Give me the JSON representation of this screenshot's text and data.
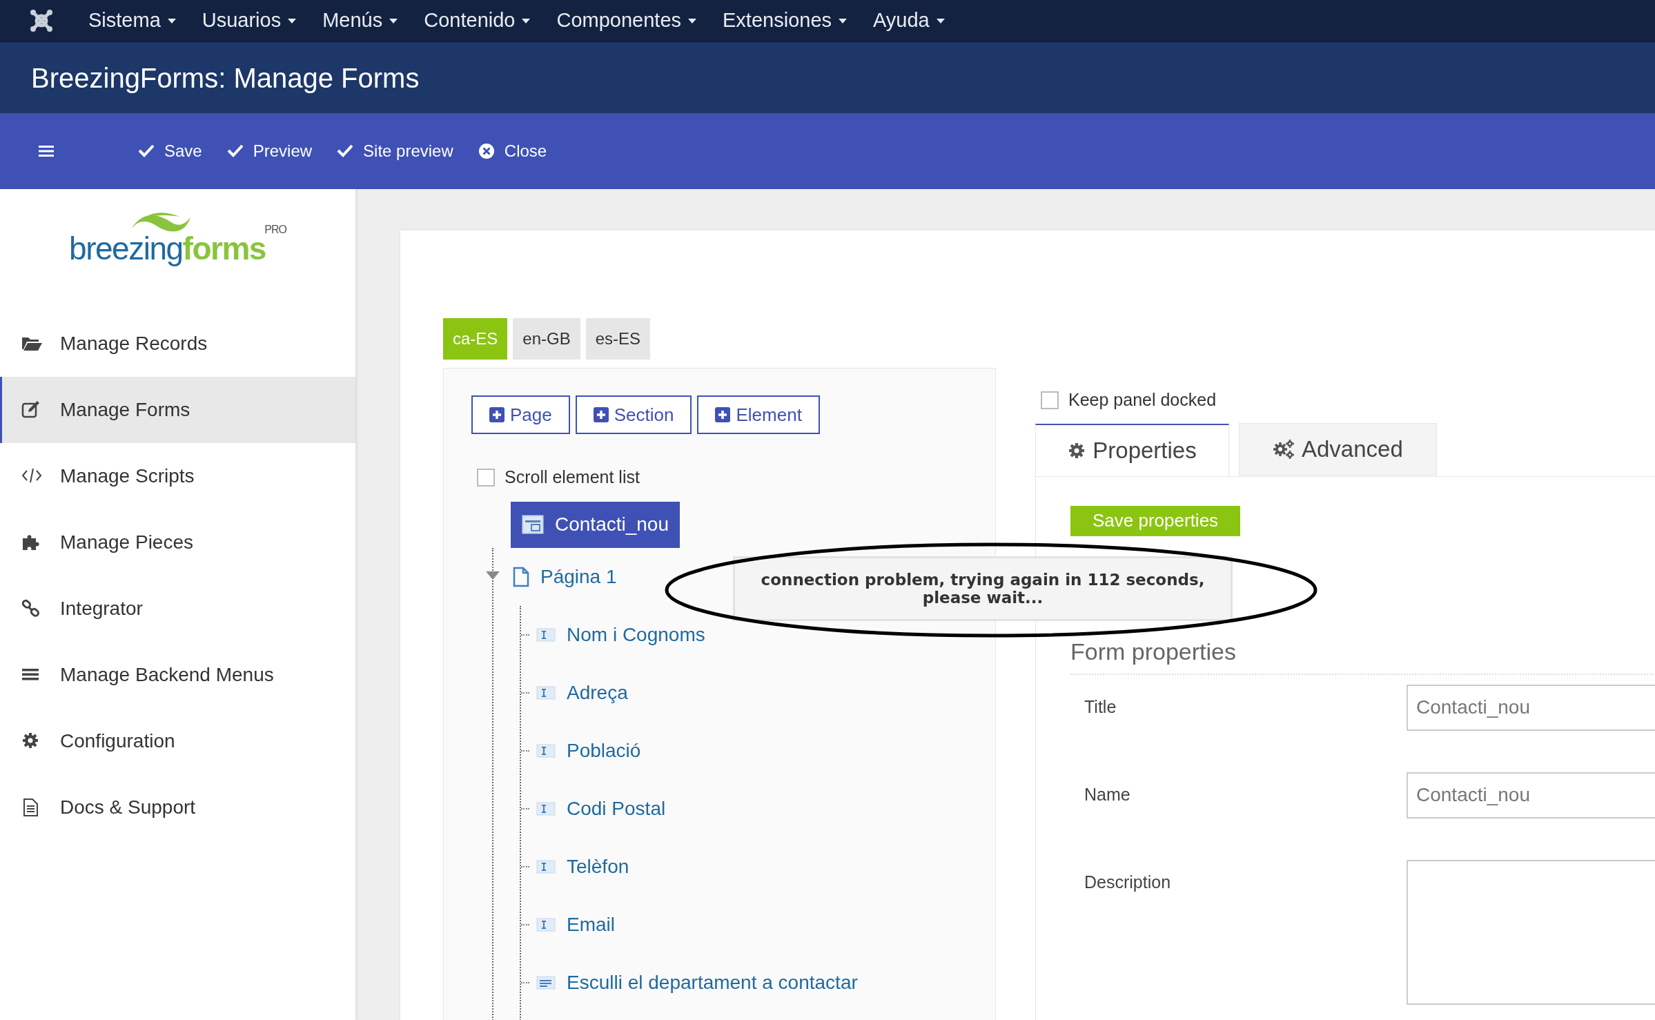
{
  "top_menu": {
    "items": [
      {
        "label": "Sistema"
      },
      {
        "label": "Usuarios"
      },
      {
        "label": "Menús"
      },
      {
        "label": "Contenido"
      },
      {
        "label": "Componentes"
      },
      {
        "label": "Extensiones"
      },
      {
        "label": "Ayuda"
      }
    ]
  },
  "header": {
    "title": "BreezingForms: Manage Forms"
  },
  "toolbar": {
    "buttons": [
      {
        "label": "Save",
        "kind": "check"
      },
      {
        "label": "Preview",
        "kind": "check"
      },
      {
        "label": "Site preview",
        "kind": "check"
      },
      {
        "label": "Close",
        "kind": "close"
      }
    ]
  },
  "sidebar": {
    "logo": {
      "word_1": "breezing",
      "word_2": "forms",
      "badge": "PRO"
    },
    "items": [
      {
        "label": "Manage Records",
        "kind": "folder",
        "selected": false
      },
      {
        "label": "Manage Forms",
        "kind": "edit",
        "selected": true
      },
      {
        "label": "Manage Scripts",
        "kind": "code",
        "selected": false
      },
      {
        "label": "Manage Pieces",
        "kind": "puzzle",
        "selected": false
      },
      {
        "label": "Integrator",
        "kind": "link",
        "selected": false
      },
      {
        "label": "Manage Backend Menus",
        "kind": "bars",
        "selected": false
      },
      {
        "label": "Configuration",
        "kind": "gear",
        "selected": false
      },
      {
        "label": "Docs & Support",
        "kind": "doc",
        "selected": false
      }
    ]
  },
  "language_tabs": [
    {
      "label": "ca-ES",
      "selected": true
    },
    {
      "label": "en-GB",
      "selected": false
    },
    {
      "label": "es-ES",
      "selected": false
    }
  ],
  "structure_panel": {
    "add_buttons": [
      {
        "label": "Page"
      },
      {
        "label": "Section"
      },
      {
        "label": "Element"
      }
    ],
    "scroll_element_list": {
      "label": "Scroll element list",
      "checked": false
    },
    "tree": {
      "label": "Contacti_nou",
      "selected": true,
      "children": [
        {
          "label": "Página 1",
          "kind": "page",
          "expanded": true,
          "children": [
            {
              "label": "Nom i Cognoms",
              "kind": "text"
            },
            {
              "label": "Adreça",
              "kind": "text"
            },
            {
              "label": "Població",
              "kind": "text"
            },
            {
              "label": "Codi Postal",
              "kind": "text"
            },
            {
              "label": "Telèfon",
              "kind": "text"
            },
            {
              "label": "Email",
              "kind": "text"
            },
            {
              "label": "Esculli el departament a contactar",
              "kind": "select"
            }
          ]
        }
      ]
    }
  },
  "properties_panel": {
    "keep_panel_docked": {
      "label": "Keep panel docked",
      "checked": false
    },
    "tabs": [
      {
        "label": "Properties",
        "kind": "gear",
        "selected": true
      },
      {
        "label": "Advanced",
        "kind": "gears",
        "selected": false
      }
    ],
    "save_button": "Save properties",
    "heading": "Form properties",
    "fields": [
      {
        "label": "Title",
        "value": "Contacti_nou",
        "kind": "input"
      },
      {
        "label": "Name",
        "value": "Contacti_nou",
        "kind": "input"
      },
      {
        "label": "Description",
        "kind": "textarea"
      }
    ]
  },
  "notification": {
    "message": "connection problem, trying again in 112 seconds, please wait..."
  }
}
